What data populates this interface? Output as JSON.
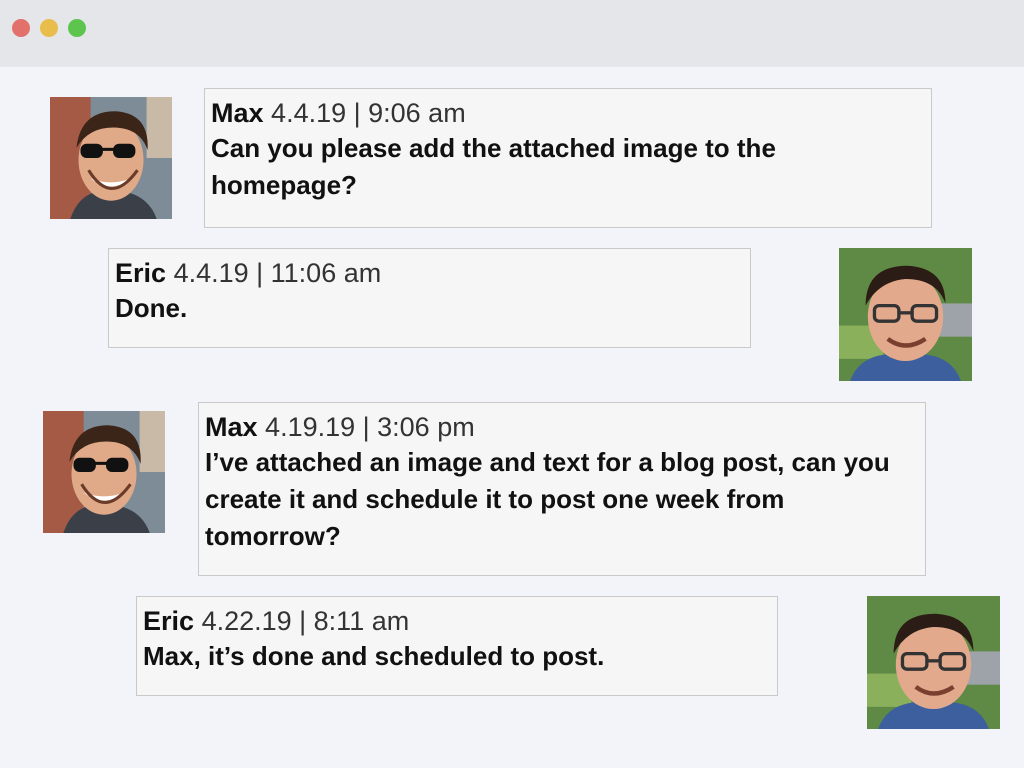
{
  "window": {
    "controls": [
      "close",
      "minimize",
      "maximize"
    ],
    "colors": {
      "close": "#e2716b",
      "minimize": "#e8bd4b",
      "maximize": "#5dc54e"
    }
  },
  "messages": [
    {
      "sender": "Max",
      "timestamp": "4.4.19 | 9:06 am",
      "text": "Can you please add the attached image to the homepage?",
      "avatar": "max-avatar"
    },
    {
      "sender": "Eric",
      "timestamp": "4.4.19 | 11:06 am",
      "text": "Done.",
      "avatar": "eric-avatar"
    },
    {
      "sender": "Max",
      "timestamp": "4.19.19 | 3:06 pm",
      "text": "I’ve attached an image and text for a blog post, can you create it and schedule it to post one week from tomorrow?",
      "avatar": "max-avatar"
    },
    {
      "sender": "Eric",
      "timestamp": "4.22.19 | 8:11 am",
      "text": "Max, it’s done and scheduled to post.",
      "avatar": "eric-avatar"
    }
  ]
}
